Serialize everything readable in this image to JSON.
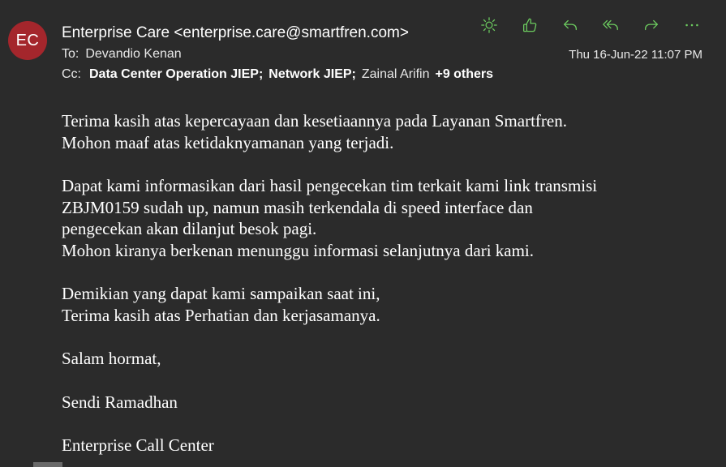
{
  "message": {
    "avatar_initials": "EC",
    "sender": "Enterprise Care <enterprise.care@smartfren.com>",
    "to_label": "To:",
    "to": "Devandio Kenan",
    "cc_label": "Cc:",
    "cc": [
      "Data Center Operation JIEP;",
      "Network JIEP;",
      "Zainal Arifin"
    ],
    "cc_more": "+9 others",
    "date": "Thu 16-Jun-22 11:07 PM"
  },
  "toolbar": {
    "icons": [
      "sun-icon",
      "like-icon",
      "reply-icon",
      "reply-all-icon",
      "forward-icon",
      "more-icon"
    ],
    "accent_color": "#6ccb5f"
  },
  "body": {
    "p1": [
      "Terima kasih atas kepercayaan dan kesetiaannya pada Layanan Smartfren.",
      "Mohon maaf atas ketidaknyamanan yang terjadi."
    ],
    "p2": [
      "Dapat kami informasikan dari hasil pengecekan tim terkait kami link transmisi",
      "ZBJM0159 sudah up, namun masih terkendala di speed interface dan",
      "pengecekan akan dilanjut besok pagi.",
      "Mohon kiranya berkenan menunggu informasi selanjutnya dari kami."
    ],
    "p3": [
      "Demikian yang dapat kami sampaikan saat ini,",
      "Terima kasih atas Perhatian dan kerjasamanya."
    ],
    "greeting": "Salam hormat,",
    "name": "Sendi Ramadhan",
    "dept": "Enterprise Call Center"
  }
}
